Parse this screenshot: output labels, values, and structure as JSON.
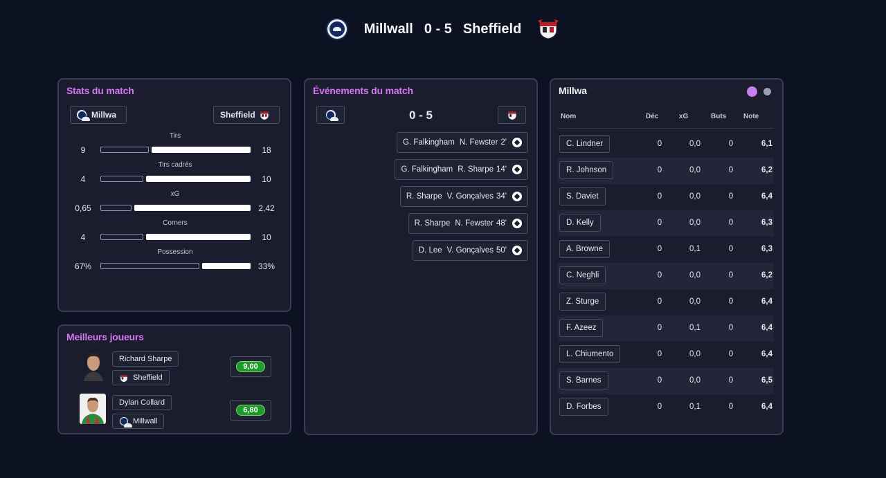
{
  "match": {
    "home_team": "Millwall",
    "away_team": "Sheffield",
    "score": "0 - 5"
  },
  "stats_panel": {
    "title": "Stats du match",
    "home_chip": "Millwa",
    "away_chip": "Sheffield",
    "rows": [
      {
        "label": "Tirs",
        "home": "9",
        "away": "18",
        "home_frac": 0.33,
        "away_frac": 0.67
      },
      {
        "label": "Tirs cadrés",
        "home": "4",
        "away": "10",
        "home_frac": 0.29,
        "away_frac": 0.71
      },
      {
        "label": "xG",
        "home": "0,65",
        "away": "2,42",
        "home_frac": 0.21,
        "away_frac": 0.79
      },
      {
        "label": "Corners",
        "home": "4",
        "away": "10",
        "home_frac": 0.29,
        "away_frac": 0.71
      },
      {
        "label": "Possession",
        "home": "67%",
        "away": "33%",
        "home_frac": 0.67,
        "away_frac": 0.33
      }
    ]
  },
  "events_panel": {
    "title": "Événements du match",
    "score": "0 - 5",
    "events": [
      {
        "scorer": "G. Falkingham",
        "assist": "N. Fewster",
        "minute": "2'"
      },
      {
        "scorer": "G. Falkingham",
        "assist": "R. Sharpe",
        "minute": "14'"
      },
      {
        "scorer": "R. Sharpe",
        "assist": "V. Gonçalves",
        "minute": "34'"
      },
      {
        "scorer": "R. Sharpe",
        "assist": "N. Fewster",
        "minute": "48'"
      },
      {
        "scorer": "D. Lee",
        "assist": "V. Gonçalves",
        "minute": "50'"
      }
    ]
  },
  "best_players": {
    "title": "Meilleurs joueurs",
    "players": [
      {
        "name": "Richard Sharpe",
        "team": "Sheffield",
        "rating": "9,00"
      },
      {
        "name": "Dylan Collard",
        "team": "Millwall",
        "rating": "6,80"
      }
    ]
  },
  "players_panel": {
    "title": "Millwa",
    "columns": {
      "name": "Nom",
      "dec": "Déc",
      "xg": "xG",
      "goals": "Buts",
      "note": "Note"
    },
    "toggle_active_color": "#c880f0",
    "toggle_inactive_color": "#9aa0b4",
    "rows": [
      {
        "name": "C. Lindner",
        "dec": "0",
        "xg": "0,0",
        "goals": "0",
        "note": "6,1"
      },
      {
        "name": "R. Johnson",
        "dec": "0",
        "xg": "0,0",
        "goals": "0",
        "note": "6,2"
      },
      {
        "name": "S. Daviet",
        "dec": "0",
        "xg": "0,0",
        "goals": "0",
        "note": "6,4"
      },
      {
        "name": "D. Kelly",
        "dec": "0",
        "xg": "0,0",
        "goals": "0",
        "note": "6,3"
      },
      {
        "name": "A. Browne",
        "dec": "0",
        "xg": "0,1",
        "goals": "0",
        "note": "6,3"
      },
      {
        "name": "C. Neghli",
        "dec": "0",
        "xg": "0,0",
        "goals": "0",
        "note": "6,2"
      },
      {
        "name": "Z. Sturge",
        "dec": "0",
        "xg": "0,0",
        "goals": "0",
        "note": "6,4"
      },
      {
        "name": "F. Azeez",
        "dec": "0",
        "xg": "0,1",
        "goals": "0",
        "note": "6,4"
      },
      {
        "name": "L. Chiumento",
        "dec": "0",
        "xg": "0,0",
        "goals": "0",
        "note": "6,4"
      },
      {
        "name": "S. Barnes",
        "dec": "0",
        "xg": "0,0",
        "goals": "0",
        "note": "6,5"
      },
      {
        "name": "D. Forbes",
        "dec": "0",
        "xg": "0,1",
        "goals": "0",
        "note": "6,4"
      }
    ]
  }
}
